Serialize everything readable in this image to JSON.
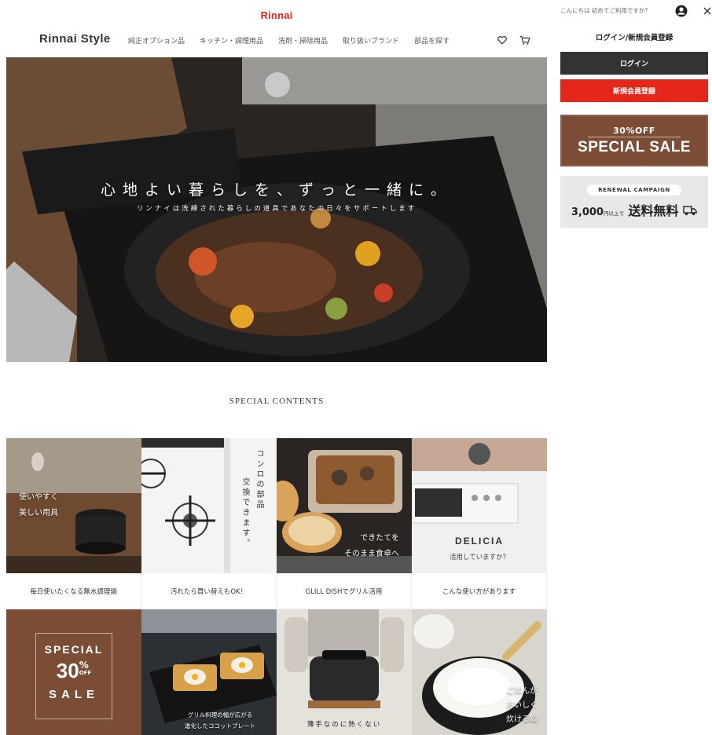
{
  "header": {
    "brand_logo": "Rinnai",
    "site_title": "Rinnai Style",
    "nav": [
      "純正オプション品",
      "キッチン・調理用品",
      "洗剤・掃除用品",
      "取り扱いブランド",
      "部品を探す"
    ]
  },
  "hero": {
    "headline": "心地よい暮らしを、ずっと一緒に。",
    "subline": "リンナイは洗練された暮らしの道具であなたの日々をサポートします"
  },
  "special": {
    "title": "SPECIAL CONTENTS",
    "tiles": [
      {
        "overlay": [
          "使いやすく",
          "美しい用具"
        ],
        "caption": "毎日使いたくなる無水調理鍋"
      },
      {
        "overlay": [
          "コンロの部品",
          "交換できます。"
        ],
        "caption": "汚れたら買い替えもOK！"
      },
      {
        "overlay": [
          "できたてを",
          "そのまま食卓へ"
        ],
        "caption": "GLILL DISHでグリル活用"
      },
      {
        "overlay": [
          "DELICIA",
          "活用していますか？"
        ],
        "caption": "こんな使い方があります"
      }
    ],
    "bottom_tiles": [
      {
        "line1": "SPECIAL",
        "percent": "30",
        "pct_sign": "%",
        "off": "OFF",
        "line3": "SALE"
      },
      {
        "overlay": [
          "グリル料理の幅が広がる",
          "進化したココットプレート"
        ]
      },
      {
        "overlay": [
          "薄手なのに熱くない"
        ]
      },
      {
        "overlay": [
          "ごはんが",
          "おいしく",
          "炊ける鍋"
        ]
      }
    ]
  },
  "sidebar": {
    "greeting": "こんにちは 初めてご利用ですか？",
    "login_heading": "ログイン/新規会員登録",
    "login_label": "ログイン",
    "register_label": "新規会員登録",
    "sale_small": "30%OFF",
    "sale_big": "SPECIAL SALE",
    "campaign_pill": "RENEWAL CAMPAIGN",
    "campaign_amount": "3,000",
    "campaign_small": "円以上で",
    "campaign_main": "送料無料"
  },
  "colors": {
    "brand_red": "#e4261b",
    "sale_brown": "#7b4d37",
    "dark_button": "#333333"
  }
}
